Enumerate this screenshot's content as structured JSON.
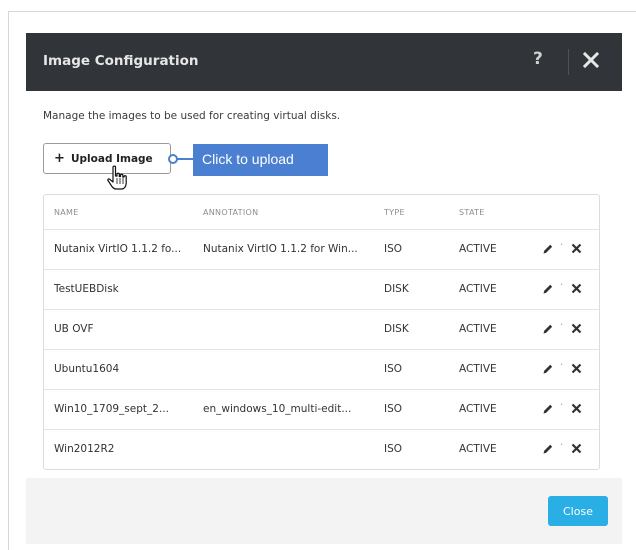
{
  "dialog": {
    "title": "Image Configuration",
    "help_label": "?",
    "description": "Manage the images to be used for creating virtual disks.",
    "upload_label": "Upload Image",
    "upload_plus": "+",
    "callout": "Click to upload",
    "close_label": "Close"
  },
  "table": {
    "headers": {
      "name": "NAME",
      "annotation": "ANNOTATION",
      "type": "TYPE",
      "state": "STATE"
    },
    "rows": [
      {
        "name": "Nutanix VirtIO 1.1.2 fo...",
        "annotation": "Nutanix VirtIO 1.1.2 for Win...",
        "type": "ISO",
        "state": "ACTIVE"
      },
      {
        "name": "TestUEBDisk",
        "annotation": "",
        "type": "DISK",
        "state": "ACTIVE"
      },
      {
        "name": "UB OVF",
        "annotation": "",
        "type": "DISK",
        "state": "ACTIVE"
      },
      {
        "name": "Ubuntu1604",
        "annotation": "",
        "type": "ISO",
        "state": "ACTIVE"
      },
      {
        "name": "Win10_1709_sept_2...",
        "annotation": "en_windows_10_multi-edit...",
        "type": "ISO",
        "state": "ACTIVE"
      },
      {
        "name": "Win2012R2",
        "annotation": "",
        "type": "ISO",
        "state": "ACTIVE"
      }
    ],
    "separator": "·"
  },
  "colors": {
    "header_bg": "#313438",
    "callout": "#4a7fd1",
    "close_button": "#2aaee6"
  },
  "icons": {
    "help": "question-icon",
    "close": "close-icon",
    "edit": "pencil-icon",
    "delete": "x-icon",
    "cursor": "hand-pointer-icon"
  }
}
